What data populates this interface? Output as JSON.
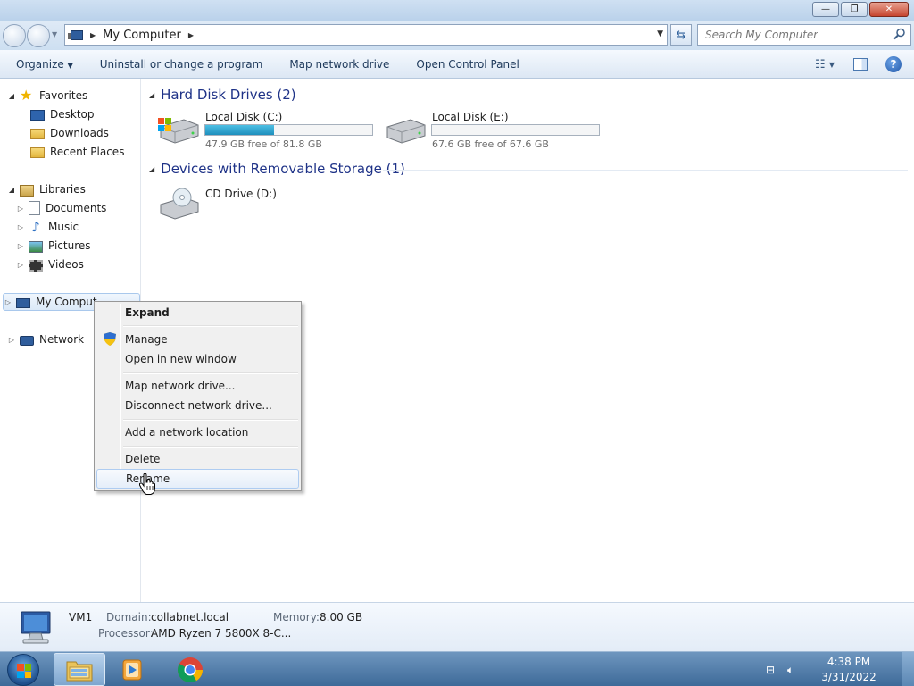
{
  "window": {
    "minimize_glyph": "—",
    "maximize_glyph": "❐",
    "close_glyph": "✕"
  },
  "address": {
    "breadcrumb": "My Computer",
    "search_placeholder": "Search My Computer"
  },
  "toolbar": {
    "organize": "Organize",
    "uninstall": "Uninstall or change a program",
    "map_drive": "Map network drive",
    "control_panel": "Open Control Panel",
    "help": "?"
  },
  "nav": {
    "favorites": "Favorites",
    "desktop": "Desktop",
    "downloads": "Downloads",
    "recent": "Recent Places",
    "libraries": "Libraries",
    "documents": "Documents",
    "music": "Music",
    "pictures": "Pictures",
    "videos": "Videos",
    "computer": "My Comput",
    "network": "Network"
  },
  "content": {
    "hdd_header": "Hard Disk Drives (2)",
    "removable_header": "Devices with Removable Storage (1)",
    "drives": [
      {
        "name": "Local Disk (C:)",
        "free": "47.9 GB free of 81.8 GB",
        "used_fraction": 0.414
      },
      {
        "name": "Local Disk (E:)",
        "free": "67.6 GB free of 67.6 GB",
        "used_fraction": 0.0
      }
    ],
    "cd": {
      "name": "CD Drive (D:)"
    }
  },
  "context_menu": {
    "expand": "Expand",
    "manage": "Manage",
    "open_new": "Open in new window",
    "map_drive": "Map network drive...",
    "disconnect": "Disconnect network drive...",
    "add_location": "Add a network location",
    "delete": "Delete",
    "rename": "Rename",
    "hovered": "Rename"
  },
  "details": {
    "name": "VM1",
    "domain_label": "Domain:",
    "domain": "collabnet.local",
    "memory_label": "Memory:",
    "memory": "8.00 GB",
    "processor_label": "Processor:",
    "processor": "AMD Ryzen 7 5800X 8-C..."
  },
  "taskbar": {
    "time": "4:38 PM",
    "date": "3/31/2022"
  },
  "colors": {
    "accent_blue": "#1e3287",
    "progress": "#26a0da"
  }
}
